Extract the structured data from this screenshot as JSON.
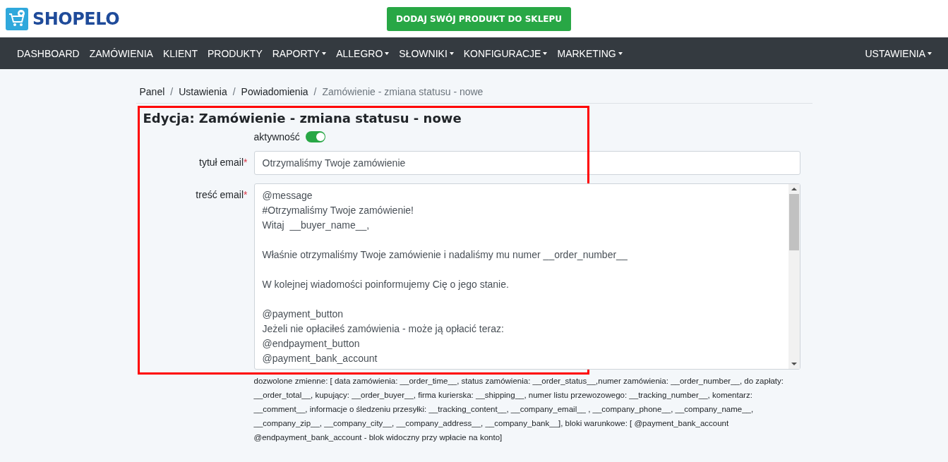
{
  "header": {
    "logo": "SHOPELO",
    "cta_button": "DODAJ SWÓJ PRODUKT DO SKLEPU"
  },
  "nav": {
    "items": [
      {
        "label": "DASHBOARD",
        "dropdown": false
      },
      {
        "label": "ZAMÓWIENIA",
        "dropdown": false
      },
      {
        "label": "KLIENT",
        "dropdown": false
      },
      {
        "label": "PRODUKTY",
        "dropdown": false
      },
      {
        "label": "RAPORTY",
        "dropdown": true
      },
      {
        "label": "ALLEGRO",
        "dropdown": true
      },
      {
        "label": "SŁOWNIKI",
        "dropdown": true
      },
      {
        "label": "KONFIGURACJE",
        "dropdown": true
      },
      {
        "label": "MARKETING",
        "dropdown": true
      }
    ],
    "right": {
      "label": "USTAWIENIA",
      "dropdown": true
    }
  },
  "breadcrumb_separator": "/",
  "breadcrumb": [
    {
      "label": "Panel",
      "selected": false
    },
    {
      "label": "Ustawienia",
      "selected": false
    },
    {
      "label": "Powiadomienia",
      "selected": false
    },
    {
      "label": "Zamówienie - zmiana statusu - nowe",
      "selected": true
    }
  ],
  "form": {
    "title": "Edycja: Zamówienie - zmiana statusu - nowe",
    "active": {
      "label": "aktywność",
      "checked": true
    },
    "subject": {
      "label": "tytuł email",
      "required_mark": "*",
      "value": "Otrzymaliśmy Twoje zamówienie"
    },
    "body": {
      "label": "treść email",
      "required_mark": "*",
      "paragraphs": [
        [
          "@message",
          "#Otrzymaliśmy Twoje zamówienie!",
          "Witaj  __buyer_name__,"
        ],
        [
          "Właśnie otrzymaliśmy Twoje zamówienie i nadaliśmy mu numer __order_number__"
        ],
        [
          "W kolejnej wiadomości poinformujemy Cię o jego stanie."
        ],
        [
          "@payment_button",
          "Jeżeli nie opłaciłeś zamówienia - może ją opłacić teraz:",
          "@endpayment_button",
          "@payment_bank_account"
        ]
      ]
    },
    "help": "dozwolone zmienne: [ data zamówienia: __order_time__, status zamówienia: __order_status__,numer zamówienia: __order_number__, do zapłaty: __order_total__, kupujący: __order_buyer__, firma kurierska: __shipping__, numer listu przewozowego: __tracking_number__, komentarz: __comment__, informacje o śledzeniu przesyłki: __tracking_content__, __company_email__ , __company_phone__, __company_name__, __company_zip__, __company_city__, __company_address__, __company_bank__], bloki warunkowe: [ @payment_bank_account @endpayment_bank_account - blok widoczny przy wpłacie na konto]"
  },
  "highlight": {
    "color": "#ff0000"
  }
}
